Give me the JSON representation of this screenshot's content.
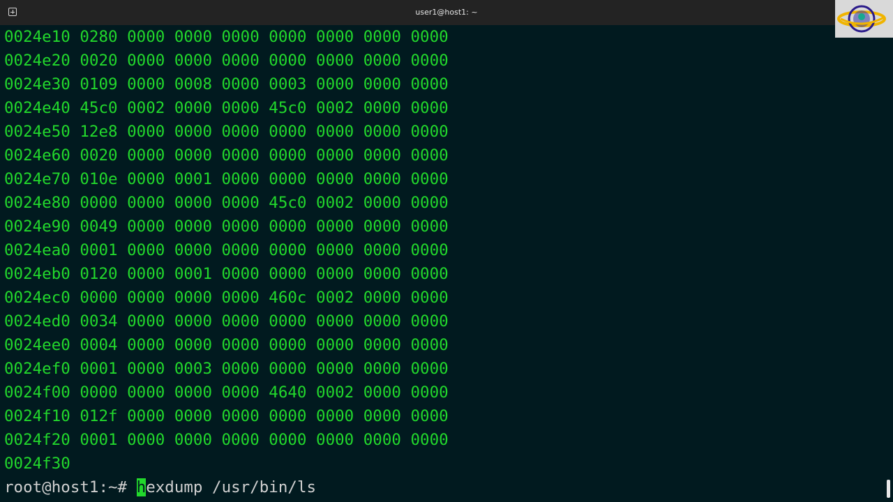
{
  "window": {
    "title": "user1@host1: ~"
  },
  "terminal": {
    "lines": [
      "0024e10 0280 0000 0000 0000 0000 0000 0000 0000",
      "0024e20 0020 0000 0000 0000 0000 0000 0000 0000",
      "0024e30 0109 0000 0008 0000 0003 0000 0000 0000",
      "0024e40 45c0 0002 0000 0000 45c0 0002 0000 0000",
      "0024e50 12e8 0000 0000 0000 0000 0000 0000 0000",
      "0024e60 0020 0000 0000 0000 0000 0000 0000 0000",
      "0024e70 010e 0000 0001 0000 0000 0000 0000 0000",
      "0024e80 0000 0000 0000 0000 45c0 0002 0000 0000",
      "0024e90 0049 0000 0000 0000 0000 0000 0000 0000",
      "0024ea0 0001 0000 0000 0000 0000 0000 0000 0000",
      "0024eb0 0120 0000 0001 0000 0000 0000 0000 0000",
      "0024ec0 0000 0000 0000 0000 460c 0002 0000 0000",
      "0024ed0 0034 0000 0000 0000 0000 0000 0000 0000",
      "0024ee0 0004 0000 0000 0000 0000 0000 0000 0000",
      "0024ef0 0001 0000 0003 0000 0000 0000 0000 0000",
      "0024f00 0000 0000 0000 0000 4640 0002 0000 0000",
      "0024f10 012f 0000 0000 0000 0000 0000 0000 0000",
      "0024f20 0001 0000 0000 0000 0000 0000 0000 0000",
      "0024f30"
    ],
    "prompt": "root@host1:~# ",
    "command_cursor_char": "h",
    "command_rest": "exdump /usr/bin/ls"
  },
  "colors": {
    "background": "#011a1f",
    "output_text": "#22d82c",
    "prompt_text": "#d0d0d0",
    "titlebar": "#232323"
  },
  "icons": {
    "new_tab": "new-tab-icon",
    "logo": "channel-logo-icon"
  }
}
